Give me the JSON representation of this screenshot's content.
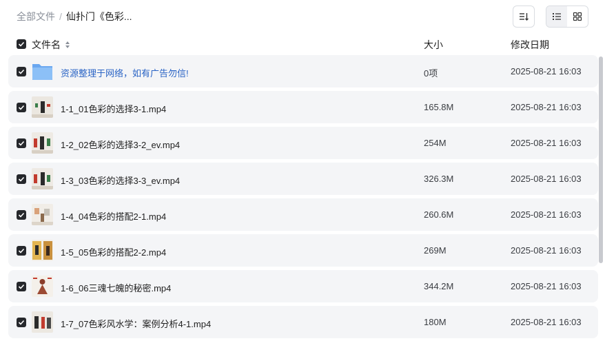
{
  "breadcrumb": {
    "root": "全部文件",
    "separator": "/",
    "current": "仙扑门《色彩..."
  },
  "columns": {
    "name": "文件名",
    "size": "大小",
    "modified": "修改日期"
  },
  "accent_color": "#2a64c5",
  "files": [
    {
      "name": "资源整理于网络，如有广告勿信!",
      "size": "0项",
      "modified": "2025-08-21 16:03",
      "type": "folder"
    },
    {
      "name": "1-1_01色彩的选择3-1.mp4",
      "size": "165.8M",
      "modified": "2025-08-21 16:03",
      "type": "video"
    },
    {
      "name": "1-2_02色彩的选择3-2_ev.mp4",
      "size": "254M",
      "modified": "2025-08-21 16:03",
      "type": "video"
    },
    {
      "name": "1-3_03色彩的选择3-3_ev.mp4",
      "size": "326.3M",
      "modified": "2025-08-21 16:03",
      "type": "video"
    },
    {
      "name": "1-4_04色彩的搭配2-1.mp4",
      "size": "260.6M",
      "modified": "2025-08-21 16:03",
      "type": "video"
    },
    {
      "name": "1-5_05色彩的搭配2-2.mp4",
      "size": "269M",
      "modified": "2025-08-21 16:03",
      "type": "video"
    },
    {
      "name": "1-6_06三魂七魄的秘密.mp4",
      "size": "344.2M",
      "modified": "2025-08-21 16:03",
      "type": "video"
    },
    {
      "name": "1-7_07色彩风水学：案例分析4-1.mp4",
      "size": "180M",
      "modified": "2025-08-21 16:03",
      "type": "video"
    }
  ]
}
